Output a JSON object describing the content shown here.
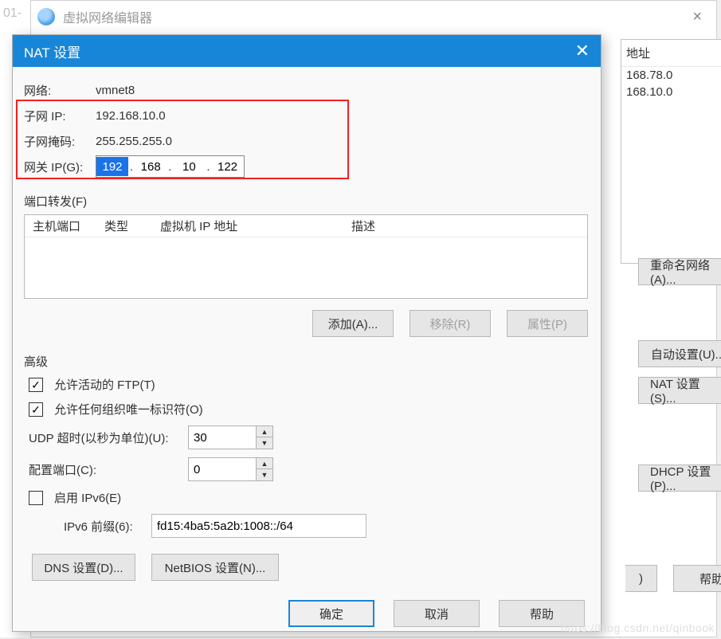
{
  "leftStripText": "01-",
  "vnet": {
    "title": "虚拟网络编辑器",
    "closeGlyph": "×",
    "listHeader": "地址",
    "listRows": [
      "168.78.0",
      "168.10.0"
    ],
    "renameBtn": "重命名网络(A)...",
    "autoSetBtn": "自动设置(U)...",
    "natSetBtn": "NAT 设置(S)...",
    "dhcpSetBtn": "DHCP 设置(P)...",
    "footerCancelStub": ")",
    "footerHelp": "帮助"
  },
  "nat": {
    "title": "NAT 设置",
    "closeGlyph": "✕",
    "netLabel": "网络:",
    "netValue": "vmnet8",
    "subnetIpLabel": "子网 IP:",
    "subnetIpValue": "192.168.10.0",
    "subnetMaskLabel": "子网掩码:",
    "subnetMaskValue": "255.255.255.0",
    "gatewayLabel": "网关 IP(G):",
    "gatewayOctets": [
      "192",
      "168",
      "10",
      "122"
    ],
    "forward": {
      "groupTitle": "端口转发(F)",
      "col1": "主机端口",
      "col2": "类型",
      "col3": "虚拟机 IP 地址",
      "col4": "描述",
      "addBtn": "添加(A)...",
      "removeBtn": "移除(R)",
      "propsBtn": "属性(P)"
    },
    "advanced": {
      "groupTitle": "高级",
      "allowFtp": "允许活动的 FTP(T)",
      "allowOui": "允许任何组织唯一标识符(O)",
      "udpTimeoutLabel": "UDP 超时(以秒为单位)(U):",
      "udpTimeoutValue": "30",
      "configPortLabel": "配置端口(C):",
      "configPortValue": "0",
      "enableIpv6": "启用 IPv6(E)",
      "ipv6PrefixLabel": "IPv6 前缀(6):",
      "ipv6PrefixValue": "fd15:4ba5:5a2b:1008::/64",
      "dnsBtn": "DNS 设置(D)...",
      "netbiosBtn": "NetBIOS 设置(N)..."
    },
    "ok": "确定",
    "cancel": "取消",
    "help": "帮助"
  },
  "watermark": "https://blog.csdn.net/qinbook"
}
